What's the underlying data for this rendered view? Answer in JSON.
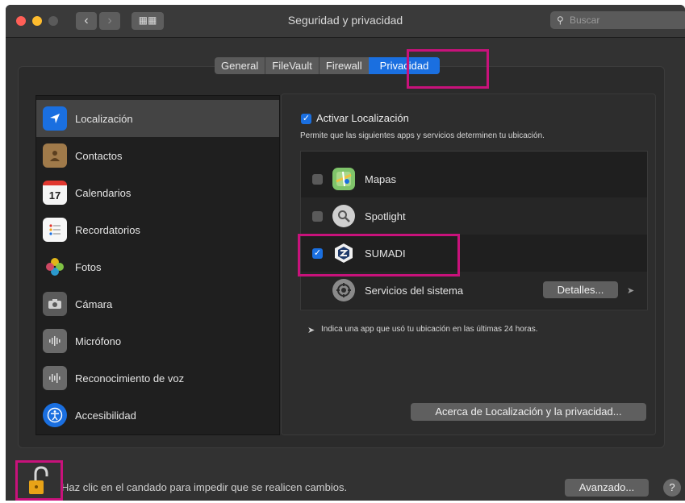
{
  "window": {
    "title": "Seguridad y privacidad",
    "search_placeholder": "Buscar"
  },
  "tabs": [
    {
      "label": "General",
      "active": false
    },
    {
      "label": "FileVault",
      "active": false
    },
    {
      "label": "Firewall",
      "active": false
    },
    {
      "label": "Privacidad",
      "active": true
    }
  ],
  "sidebar": {
    "items": [
      {
        "label": "Localización",
        "icon": "location-arrow-icon",
        "selected": true
      },
      {
        "label": "Contactos",
        "icon": "contacts-icon",
        "selected": false
      },
      {
        "label": "Calendarios",
        "icon": "calendar-icon",
        "selected": false
      },
      {
        "label": "Recordatorios",
        "icon": "reminders-icon",
        "selected": false
      },
      {
        "label": "Fotos",
        "icon": "photos-icon",
        "selected": false
      },
      {
        "label": "Cámara",
        "icon": "camera-icon",
        "selected": false
      },
      {
        "label": "Micrófono",
        "icon": "microphone-icon",
        "selected": false
      },
      {
        "label": "Reconocimiento de voz",
        "icon": "speech-recognition-icon",
        "selected": false
      },
      {
        "label": "Accesibilidad",
        "icon": "accessibility-icon",
        "selected": false
      }
    ]
  },
  "location": {
    "enable_label": "Activar Localización",
    "enable_checked": true,
    "description": "Permite que las siguientes apps y servicios determinen tu ubicación.",
    "apps": [
      {
        "name": "Mapas",
        "checked": false,
        "icon": "maps-icon"
      },
      {
        "name": "Spotlight",
        "checked": false,
        "icon": "spotlight-icon"
      },
      {
        "name": "SUMADI",
        "checked": true,
        "icon": "sumadi-icon"
      },
      {
        "name": "Servicios del sistema",
        "icon": "system-services-icon"
      }
    ],
    "details_label": "Detalles...",
    "note": "Indica una app que usó tu ubicación en las últimas 24 horas.",
    "about_label": "Acerca de Localización y la privacidad..."
  },
  "footer": {
    "lock_text": "Haz clic en el candado para impedir que se realicen cambios.",
    "advanced_label": "Avanzado...",
    "help_label": "?"
  },
  "colors": {
    "accent": "#1a6fe0",
    "highlight": "#c8127b",
    "window_bg": "#323232",
    "list_bg": "#1f1f1f"
  }
}
